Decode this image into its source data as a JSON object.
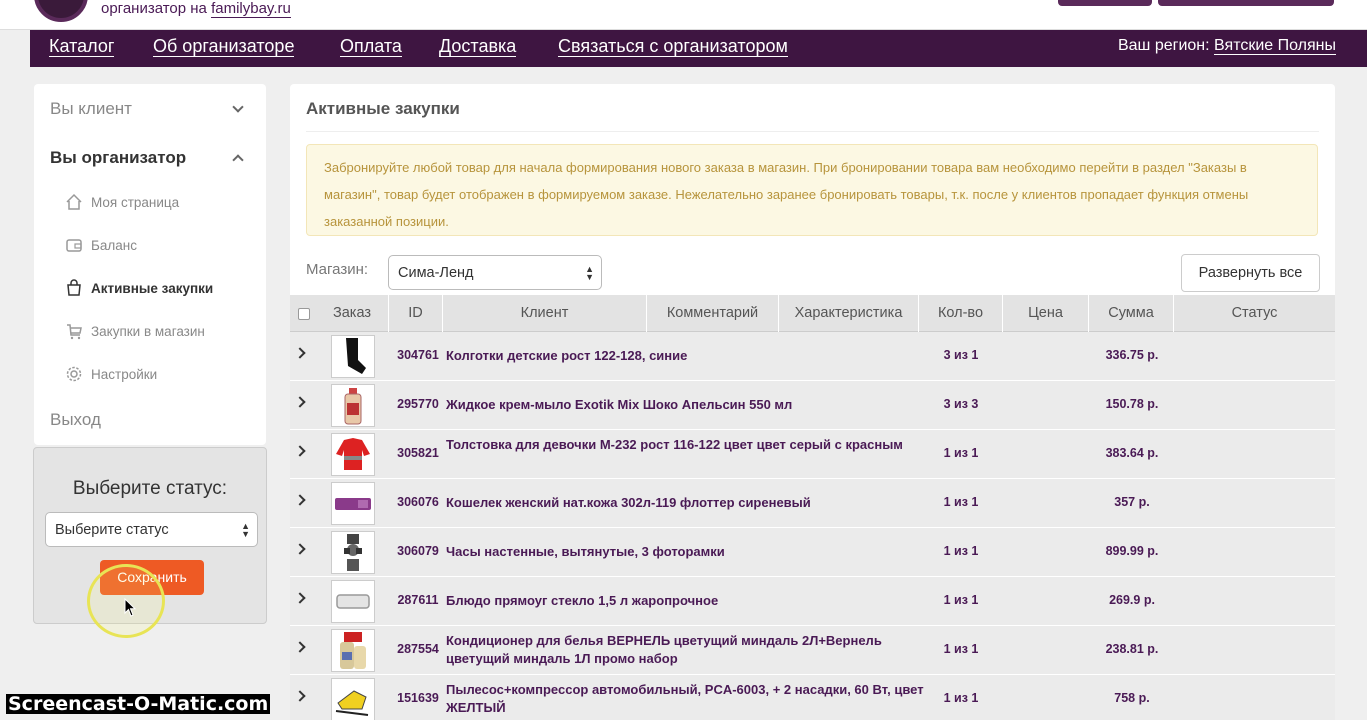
{
  "header": {
    "org_line": "организатор на",
    "org_site": "familybay.ru"
  },
  "nav": {
    "items": [
      "Каталог",
      "Об организаторе",
      "Оплата",
      "Доставка",
      "Связаться с организатором"
    ],
    "region_label": "Ваш регион:",
    "region_value": "Вятские Поляны"
  },
  "sidebar": {
    "client": "Вы клиент",
    "organizer": "Вы организатор",
    "subitems": [
      {
        "label": "Моя страница",
        "icon": "home-icon"
      },
      {
        "label": "Баланс",
        "icon": "wallet-icon"
      },
      {
        "label": "Активные закупки",
        "icon": "bag-icon"
      },
      {
        "label": "Закупки в магазин",
        "icon": "cart-icon"
      },
      {
        "label": "Настройки",
        "icon": "gear-icon"
      }
    ],
    "logout": "Выход"
  },
  "status_panel": {
    "title": "Выберите статус:",
    "select_value": "Выберите статус",
    "save_label": "Сохранить"
  },
  "main": {
    "title": "Активные закупки",
    "alert": "Забронируйте любой товар для начала формирования нового заказа в магазин. При бронировании товара вам необходимо перейти в раздел \"Заказы в магазин\", товар будет отображен в формируемом заказе. Нежелательно заранее бронировать товары, т.к. после у клиентов пропадает функция отмены заказанной позиции.",
    "shop_label": "Магазин:",
    "shop_value": "Сима-Ленд",
    "expand_label": "Развернуть все"
  },
  "table": {
    "columns": [
      "Заказ",
      "ID",
      "Клиент",
      "Комментарий",
      "Характеристика",
      "Кол-во",
      "Цена",
      "Сумма",
      "Статус"
    ],
    "rows": [
      {
        "id": "304761",
        "client": "Колготки детские рост 122-128, синие",
        "qty": "3 из 1",
        "sum": "336.75 р.",
        "thumb": "tights"
      },
      {
        "id": "295770",
        "client": "Жидкое крем-мыло Exotik Mix Шоко Апельсин 550 мл",
        "qty": "3 из 3",
        "sum": "150.78 р.",
        "thumb": "soap"
      },
      {
        "id": "305821",
        "client": "Толстовка для девочки М-232 рост 116-122 цвет цвет серый с красным",
        "qty": "1 из 1",
        "sum": "383.64 р.",
        "thumb": "hoodie"
      },
      {
        "id": "306076",
        "client": "Кошелек женский нат.кожа 302л-119 флоттер сиреневый",
        "qty": "1 из 1",
        "sum": "357 р.",
        "thumb": "wallet"
      },
      {
        "id": "306079",
        "client": "Часы настенные, вытянутые, 3 фоторамки",
        "qty": "1 из 1",
        "sum": "899.99 р.",
        "thumb": "clock"
      },
      {
        "id": "287611",
        "client": "Блюдо прямоуг стекло 1,5 л жаропрочное",
        "qty": "1 из 1",
        "sum": "269.9 р.",
        "thumb": "dish"
      },
      {
        "id": "287554",
        "client": "Кондиционер для белья ВЕРНЕЛЬ цветущий миндаль 2Л+Вернель цветущий миндаль 1Л промо набор",
        "qty": "1 из 1",
        "sum": "238.81 р.",
        "thumb": "bottles"
      },
      {
        "id": "151639",
        "client": "Пылесос+компрессор автомобильный, PCA-6003, + 2 насадки, 60 Вт, цвет ЖЕЛТЫЙ",
        "qty": "1 из 1",
        "sum": "758 р.",
        "thumb": "vacuum"
      }
    ]
  },
  "watermark": "Screencast-O-Matic.com",
  "colors": {
    "nav_bg": "#3e1541",
    "accent_text": "#4a1a55",
    "save_btn": "#ee5a24",
    "alert_bg": "#fcf8e3"
  }
}
